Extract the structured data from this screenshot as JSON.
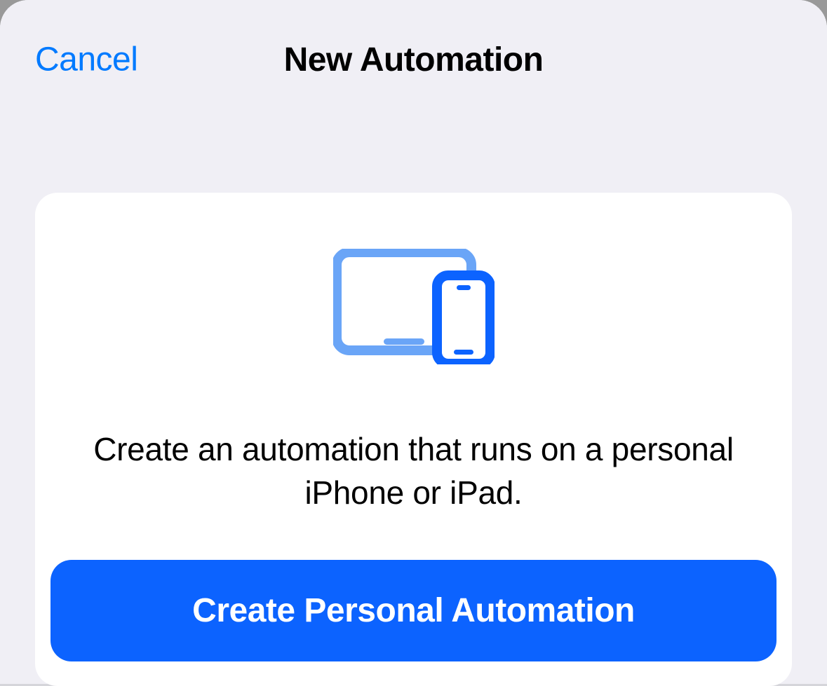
{
  "header": {
    "cancel_label": "Cancel",
    "title": "New Automation"
  },
  "card": {
    "description": "Create an automation that runs on a personal iPhone or iPad.",
    "button_label": "Create Personal Automation"
  },
  "colors": {
    "accent": "#007aff",
    "button_bg": "#0c63ff",
    "background": "#f0eff5",
    "card_bg": "#ffffff"
  }
}
